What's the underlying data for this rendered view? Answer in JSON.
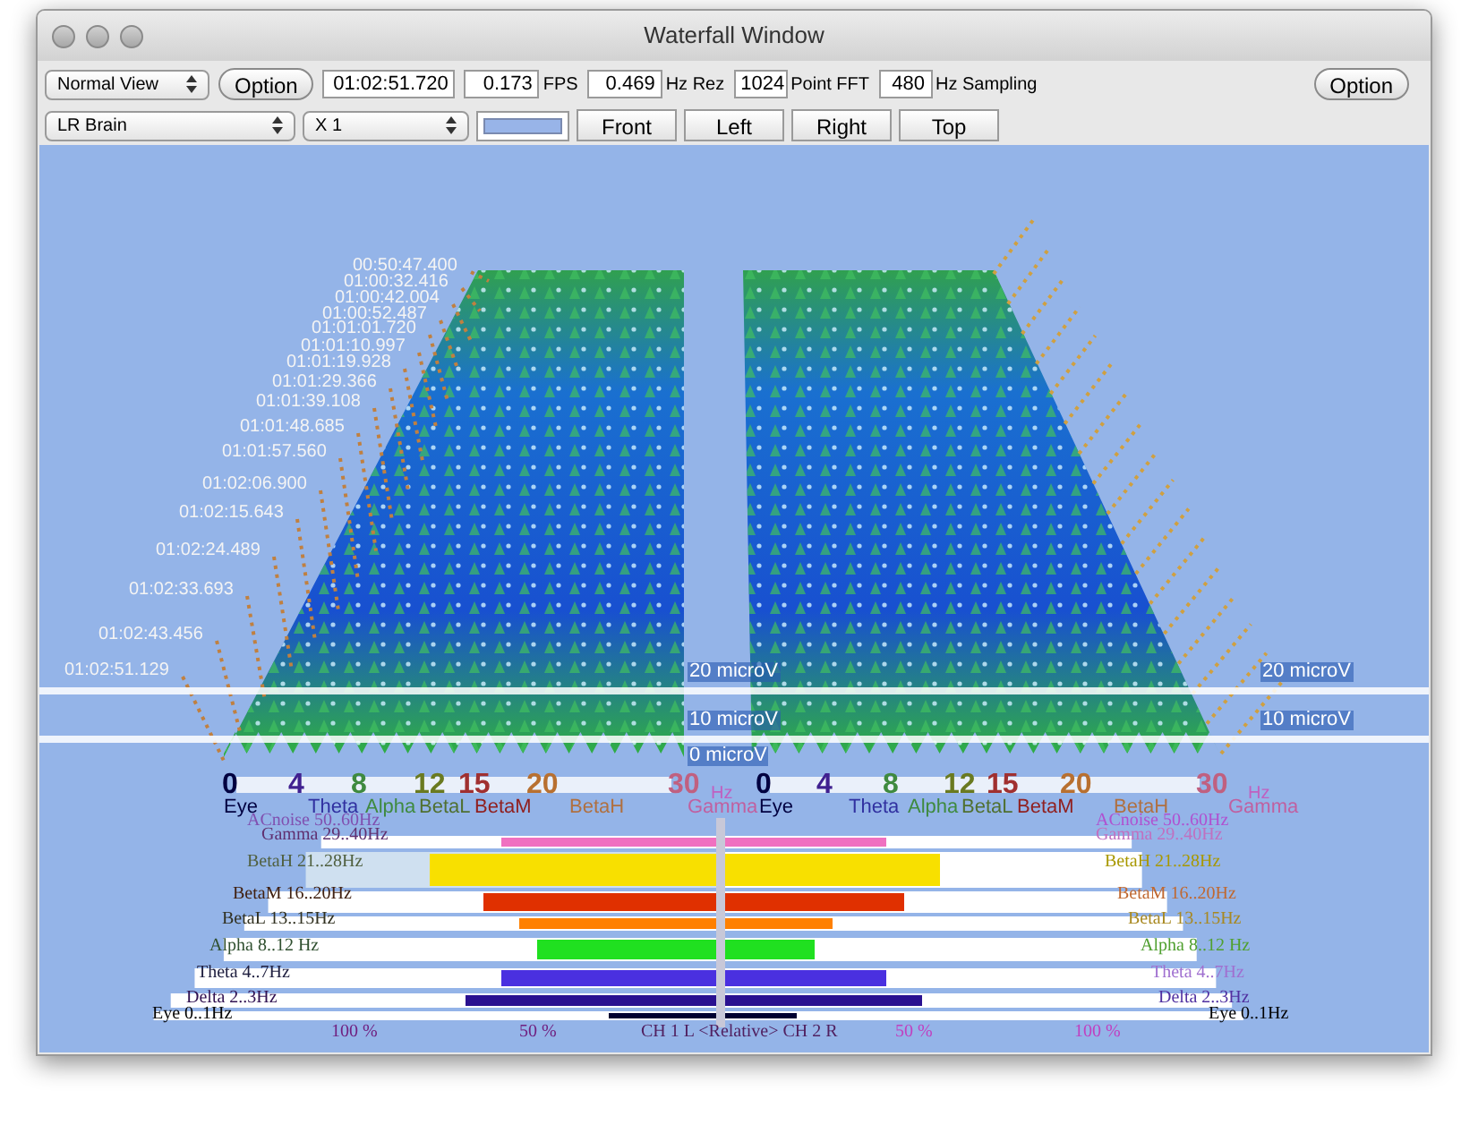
{
  "window": {
    "title": "Waterfall Window"
  },
  "toolbar": {
    "row1": [
      {
        "kind": "select",
        "value": "Normal View"
      },
      {
        "kind": "button",
        "label": "Option"
      },
      {
        "kind": "field",
        "value": "01:02:51.720"
      },
      {
        "kind": "field",
        "value": "0.173",
        "unit": "FPS"
      },
      {
        "kind": "field",
        "value": "0.469",
        "unit": "Hz Rez"
      },
      {
        "kind": "field",
        "value": "1024",
        "unit": "Point FFT"
      },
      {
        "kind": "field",
        "value": "480",
        "unit": "Hz Sampling"
      }
    ],
    "right_button": "Option",
    "row2": [
      {
        "kind": "select",
        "value": "LR Brain"
      },
      {
        "kind": "select",
        "value": "X 1"
      },
      {
        "kind": "swatch"
      },
      {
        "kind": "button",
        "label": "Front"
      },
      {
        "kind": "button",
        "label": "Left"
      },
      {
        "kind": "button",
        "label": "Right"
      },
      {
        "kind": "button",
        "label": "Top"
      }
    ]
  },
  "timestamps": [
    "00:50:47.400",
    "01:00:32.416",
    "01:00:42.004",
    "01:00:52.487",
    "01:01:01.720",
    "01:01:10.997",
    "01:01:19.928",
    "01:01:29.366",
    "01:01:39.108",
    "01:01:48.685",
    "01:01:57.560",
    "01:02:06.900",
    "01:02:15.643",
    "01:02:24.489",
    "01:02:33.693",
    "01:02:43.456",
    "01:02:51.129"
  ],
  "amplitude_labels": {
    "left": [
      "20 microV",
      "10 microV",
      "0 microV"
    ],
    "right": [
      "20 microV",
      "10 microV"
    ]
  },
  "frequency_axes": [
    {
      "ticks": [
        {
          "label": "0",
          "color": "#000040"
        },
        {
          "label": "4",
          "color": "#402090"
        },
        {
          "label": "8",
          "color": "#3f8a3f"
        },
        {
          "label": "12",
          "color": "#6a7a20"
        },
        {
          "label": "15",
          "color": "#a03030"
        },
        {
          "label": "20",
          "color": "#b87030"
        },
        {
          "label": "30",
          "color": "#c06080"
        }
      ],
      "bands": [
        {
          "label": "Eye",
          "color": "#000040"
        },
        {
          "label": "Theta",
          "color": "#3030a0"
        },
        {
          "label": "Alpha",
          "color": "#3f8a3f"
        },
        {
          "label": "BetaL",
          "color": "#507030"
        },
        {
          "label": "BetaM",
          "color": "#902020"
        },
        {
          "label": "BetaH",
          "color": "#b07040"
        },
        {
          "label": "Gamma",
          "color": "#c060a0"
        }
      ],
      "unit": "Hz"
    },
    {
      "ticks": [
        {
          "label": "0",
          "color": "#000040"
        },
        {
          "label": "4",
          "color": "#402090"
        },
        {
          "label": "8",
          "color": "#3f8a3f"
        },
        {
          "label": "12",
          "color": "#6a7a20"
        },
        {
          "label": "15",
          "color": "#a03030"
        },
        {
          "label": "20",
          "color": "#b87030"
        },
        {
          "label": "30",
          "color": "#c06080"
        }
      ],
      "bands": [
        {
          "label": "Eye",
          "color": "#000040"
        },
        {
          "label": "Theta",
          "color": "#3030a0"
        },
        {
          "label": "Alpha",
          "color": "#3f8a3f"
        },
        {
          "label": "BetaL",
          "color": "#507030"
        },
        {
          "label": "BetaM",
          "color": "#902020"
        },
        {
          "label": "BetaH",
          "color": "#b07040"
        },
        {
          "label": "Gamma",
          "color": "#c060a0"
        }
      ],
      "unit": "Hz"
    }
  ],
  "band_legend": {
    "left": [
      {
        "label": "ACnoise 50..60Hz",
        "color": "#8050b0"
      },
      {
        "label": "Gamma 29..40Hz",
        "color": "#603070"
      },
      {
        "label": "BetaH 21..28Hz",
        "color": "#506040"
      },
      {
        "label": "BetaM 16..20Hz",
        "color": "#402010"
      },
      {
        "label": "BetaL 13..15Hz",
        "color": "#303020"
      },
      {
        "label": "Alpha 8..12 Hz",
        "color": "#305030"
      },
      {
        "label": "Theta 4..7Hz",
        "color": "#202040"
      },
      {
        "label": "Delta 2..3Hz",
        "color": "#301050"
      },
      {
        "label": "Eye 0..1Hz",
        "color": "#000000"
      }
    ],
    "right": [
      {
        "label": "ACnoise 50..60Hz",
        "color": "#b050d0"
      },
      {
        "label": "Gamma 29..40Hz",
        "color": "#c070c0"
      },
      {
        "label": "BetaH 21..28Hz",
        "color": "#a89800"
      },
      {
        "label": "BetaM 16..20Hz",
        "color": "#c06830"
      },
      {
        "label": "BetaL 13..15Hz",
        "color": "#a88820"
      },
      {
        "label": "Alpha 8..12 Hz",
        "color": "#50a030"
      },
      {
        "label": "Theta 4..7Hz",
        "color": "#a070d0"
      },
      {
        "label": "Delta 2..3Hz",
        "color": "#5030a0"
      },
      {
        "label": "Eye 0..1Hz",
        "color": "#000000"
      }
    ]
  },
  "bottom_labels": [
    {
      "label": "100 %",
      "color": "#702080"
    },
    {
      "label": "50 %",
      "color": "#702080"
    },
    {
      "label": "CH 1 L <Relative> CH 2 R",
      "color": "#502060"
    },
    {
      "label": "50 %",
      "color": "#c040c0"
    },
    {
      "label": "100 %",
      "color": "#c040c0"
    }
  ]
}
